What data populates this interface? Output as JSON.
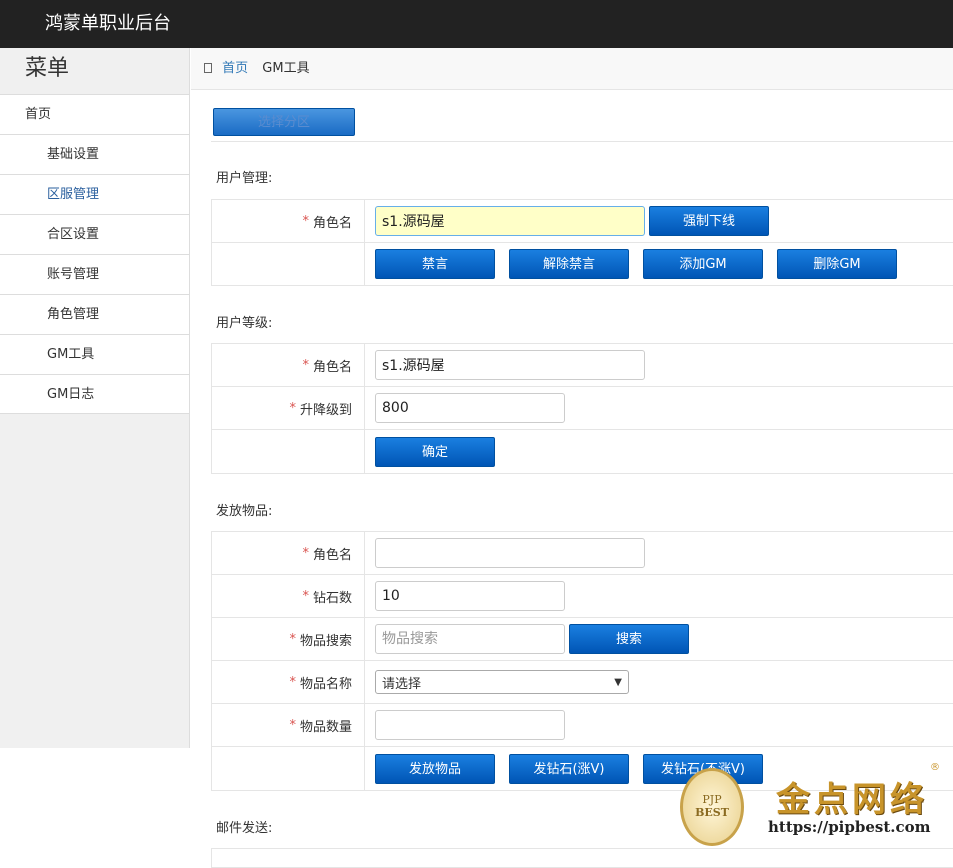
{
  "app": {
    "title": "鸿蒙单职业后台"
  },
  "sidebar": {
    "title": "菜单",
    "items": [
      {
        "label": "首页"
      },
      {
        "label": "基础设置"
      },
      {
        "label": "区服管理"
      },
      {
        "label": "合区设置"
      },
      {
        "label": "账号管理"
      },
      {
        "label": "角色管理"
      },
      {
        "label": "GM工具"
      },
      {
        "label": "GM日志"
      }
    ]
  },
  "breadcrumb": {
    "home": "首页",
    "current": "GM工具"
  },
  "toolbar": {
    "select_partition": "选择分区"
  },
  "user_manage": {
    "title": "用户管理:",
    "role_label": "角色名",
    "role_value": "s1.源码屋",
    "force_offline": "强制下线",
    "ban_chat": "禁言",
    "unban_chat": "解除禁言",
    "add_gm": "添加GM",
    "remove_gm": "删除GM"
  },
  "user_level": {
    "title": "用户等级:",
    "role_label": "角色名",
    "role_value": "s1.源码屋",
    "level_label": "升降级到",
    "level_value": "800",
    "confirm": "确定"
  },
  "give_items": {
    "title": "发放物品:",
    "role_label": "角色名",
    "role_value": "",
    "diamond_label": "钻石数",
    "diamond_value": "10",
    "search_label": "物品搜索",
    "search_placeholder": "物品搜索",
    "search_button": "搜索",
    "name_label": "物品名称",
    "name_selected": "请选择",
    "qty_label": "物品数量",
    "qty_value": "",
    "send_items": "发放物品",
    "send_diamond_v": "发钻石(涨V)",
    "send_diamond_nov": "发钻石(不涨V)"
  },
  "mail": {
    "title": "邮件发送:"
  },
  "watermark": {
    "badge_top": "PJP",
    "badge_bottom": "BEST",
    "brand": "金点网络",
    "url": "https://pipbest.com",
    "reg": "®"
  },
  "colors": {
    "topbar": "#222222",
    "button": "#0a6ad0",
    "required": "#d9534f",
    "active_link": "#2a5f9e"
  }
}
